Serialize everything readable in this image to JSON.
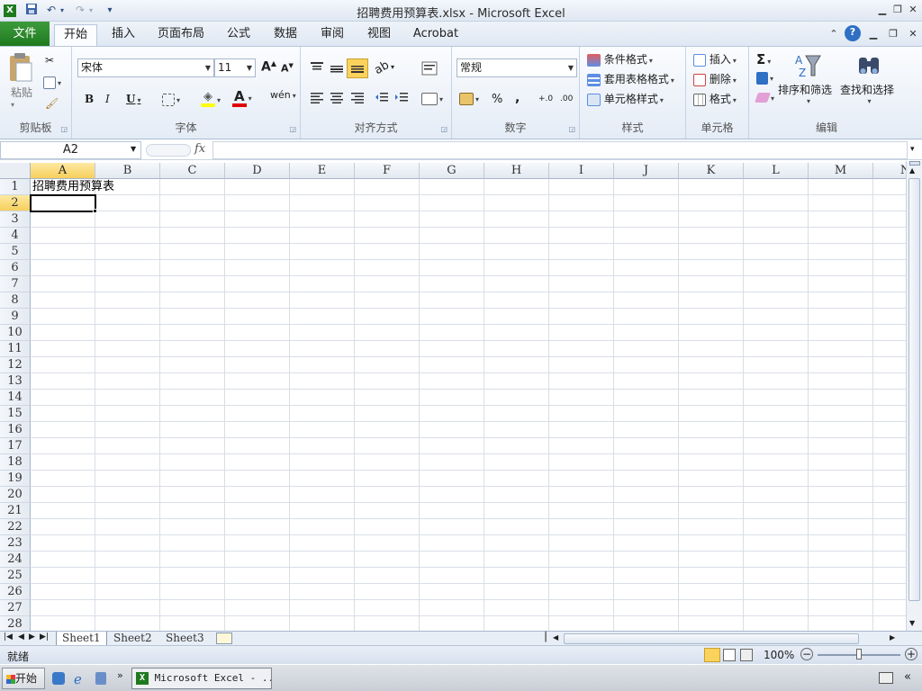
{
  "window": {
    "title": "招聘费用预算表.xlsx - Microsoft Excel"
  },
  "quick_access": {
    "dropdown": "▾"
  },
  "tabs": [
    "文件",
    "开始",
    "插入",
    "页面布局",
    "公式",
    "数据",
    "审阅",
    "视图",
    "Acrobat"
  ],
  "ribbon": {
    "clipboard": {
      "label": "剪贴板",
      "paste": "粘贴"
    },
    "font": {
      "label": "字体",
      "font_name": "宋体",
      "font_size": "11",
      "bold": "B",
      "italic": "I",
      "underline": "U",
      "grow": "A",
      "shrink": "A",
      "font_color_glyph": "A",
      "phonetic": "wén"
    },
    "alignment": {
      "label": "对齐方式"
    },
    "number": {
      "label": "数字",
      "format": "常规",
      "percent": "%",
      "comma": ",",
      "inc_decimal": "+.0",
      "dec_decimal": ".00"
    },
    "styles": {
      "label": "样式",
      "conditional": "条件格式",
      "table": "套用表格格式",
      "cell_styles": "单元格样式"
    },
    "cells": {
      "label": "单元格",
      "insert": "插入",
      "delete": "删除",
      "format": "格式"
    },
    "editing": {
      "label": "编辑",
      "sigma": "Σ",
      "sort_filter": "排序和筛选",
      "find_select": "查找和选择"
    }
  },
  "formula_bar": {
    "name_box": "A2",
    "fx": "fx",
    "value": ""
  },
  "columns": [
    "A",
    "B",
    "C",
    "D",
    "E",
    "F",
    "G",
    "H",
    "I",
    "J",
    "K",
    "L",
    "M",
    "N"
  ],
  "rows": [
    "1",
    "2",
    "3",
    "4",
    "5",
    "6",
    "7",
    "8",
    "9",
    "10",
    "11",
    "12",
    "13",
    "14",
    "15",
    "16",
    "17",
    "18",
    "19",
    "20",
    "21",
    "22",
    "23",
    "24",
    "25",
    "26",
    "27",
    "28"
  ],
  "cells": {
    "A1": "招聘费用预算表",
    "A2": ""
  },
  "selected_cell": "A2",
  "sheets": [
    "Sheet1",
    "Sheet2",
    "Sheet3"
  ],
  "active_sheet": "Sheet1",
  "status": {
    "ready": "就绪",
    "zoom": "100%"
  },
  "taskbar": {
    "start": "开始",
    "window_item": "Microsoft Excel - ..."
  },
  "colors": {
    "file_tab": "#217821",
    "selection_header": "#f7cf5b",
    "ribbon_bg": "#e4ecf6"
  }
}
